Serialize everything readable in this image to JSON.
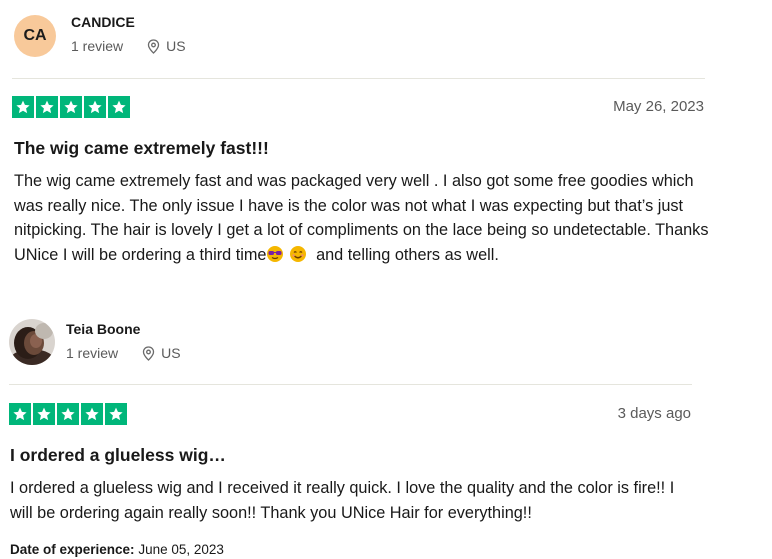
{
  "reviews": [
    {
      "reviewer": {
        "initials": "CA",
        "name": "CANDICE",
        "count": "1 review",
        "country": "US"
      },
      "rating": 5,
      "date": "May 26, 2023",
      "title": "The wig came extremely fast!!!",
      "body_main": "The wig came extremely fast and was packaged very well . I also got some free goodies which was really nice. The only issue I have is the color was not what I was expecting but that’s just nitpicking. The hair is lovely I get a lot of compliments on the lace being so undetectable. Thanks UNice I will be ordering a third time",
      "body_end": "and telling others as well."
    },
    {
      "reviewer": {
        "name": "Teia Boone",
        "count": "1 review",
        "country": "US"
      },
      "rating": 5,
      "date": "3 days ago",
      "title": "I ordered a glueless wig…",
      "body": "I ordered a glueless wig and I received it really quick. I love the quality and the color is fire!! I will be ordering again really soon!! Thank you UNice Hair for everything!!",
      "experience_label": "Date of experience:",
      "experience_date": "June 05, 2023"
    }
  ],
  "colors": {
    "star_green": "#00b67a",
    "avatar_bg": "#f8c99a"
  },
  "icons": [
    "location-pin-icon",
    "star-icon",
    "sunglasses-emoji-icon",
    "smiling-face-emoji-icon"
  ]
}
